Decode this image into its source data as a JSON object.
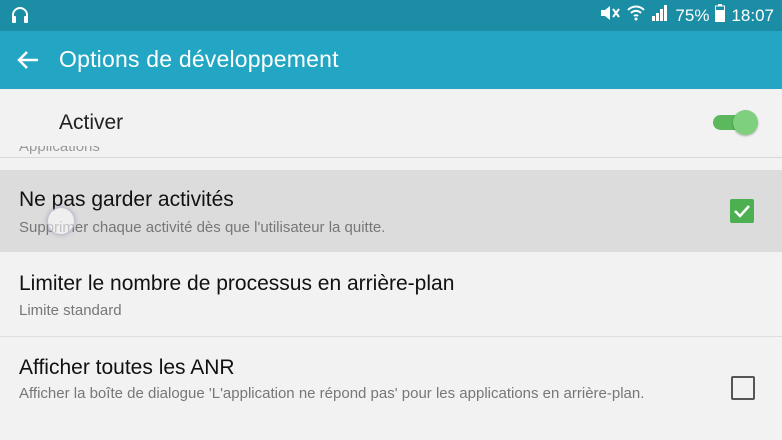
{
  "status_bar": {
    "battery": "75%",
    "time": "18:07",
    "icons": [
      "headphones-icon",
      "mute-icon",
      "wifi-icon",
      "signal-icon",
      "battery-icon"
    ]
  },
  "app_bar": {
    "title": "Options de développement",
    "back_icon": "arrow-back-icon"
  },
  "master_switch": {
    "label": "Activer",
    "on": true
  },
  "section_header_partial": "Applications",
  "settings": [
    {
      "title": "Ne pas garder activités",
      "summary": "Supprimer chaque activité dès que l'utilisateur la quitte.",
      "checked": true,
      "pressed": true
    },
    {
      "title": "Limiter le nombre de processus en arrière-plan",
      "summary": "Limite standard"
    },
    {
      "title": "Afficher toutes les ANR",
      "summary": "Afficher la boîte de dialogue 'L'application ne répond pas' pour les applications en arrière-plan.",
      "checked": false
    }
  ],
  "colors": {
    "status_bar": "#1b8ea5",
    "app_bar": "#22a6c4",
    "accent_green": "#4caf50"
  }
}
